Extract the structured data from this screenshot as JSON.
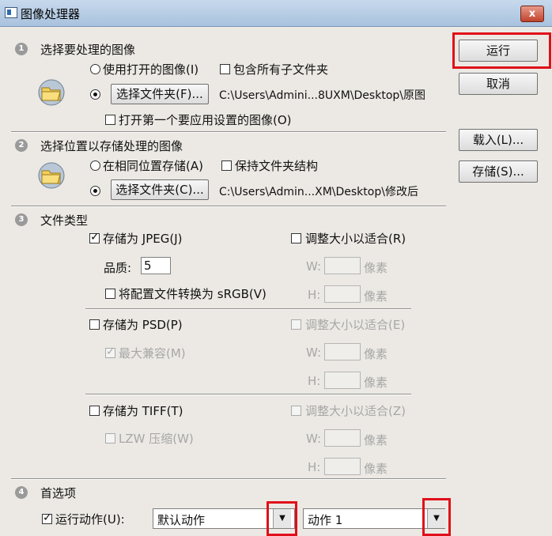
{
  "window": {
    "title": "图像处理器",
    "close_label": "x"
  },
  "section1": {
    "number": "1",
    "title": "选择要处理的图像",
    "use_open_label": "使用打开的图像(I)",
    "include_subfolders_label": "包含所有子文件夹",
    "choose_folder_label": "选择文件夹(F)...",
    "folder_path": "C:\\Users\\Admini...8UXM\\Desktop\\原图",
    "open_first_label": "打开第一个要应用设置的图像(O)"
  },
  "section2": {
    "number": "2",
    "title": "选择位置以存储处理的图像",
    "same_location_label": "在相同位置存储(A)",
    "keep_structure_label": "保持文件夹结构",
    "choose_folder_label": "选择文件夹(C)...",
    "folder_path": "C:\\Users\\Admin...XM\\Desktop\\修改后"
  },
  "section3": {
    "number": "3",
    "title": "文件类型",
    "jpeg": {
      "save_label": "存储为 JPEG(J)",
      "resize_label": "调整大小以适合(R)",
      "quality_label": "品质:",
      "quality_value": "5",
      "w_label": "W:",
      "h_label": "H:",
      "unit": "像素",
      "convert_label": "将配置文件转换为 sRGB(V)"
    },
    "psd": {
      "save_label": "存储为 PSD(P)",
      "resize_label": "调整大小以适合(E)",
      "max_compat_label": "最大兼容(M)",
      "w_label": "W:",
      "h_label": "H:",
      "unit": "像素"
    },
    "tiff": {
      "save_label": "存储为 TIFF(T)",
      "resize_label": "调整大小以适合(Z)",
      "lzw_label": "LZW 压缩(W)",
      "w_label": "W:",
      "h_label": "H:",
      "unit": "像素"
    }
  },
  "section4": {
    "number": "4",
    "title": "首选项",
    "run_action_label": "运行动作(U):",
    "action_set_value": "默认动作",
    "action_value": "动作 1",
    "arrow": "▼"
  },
  "buttons": {
    "run": "运行",
    "cancel": "取消",
    "load": "载入(L)...",
    "save": "存储(S)..."
  }
}
